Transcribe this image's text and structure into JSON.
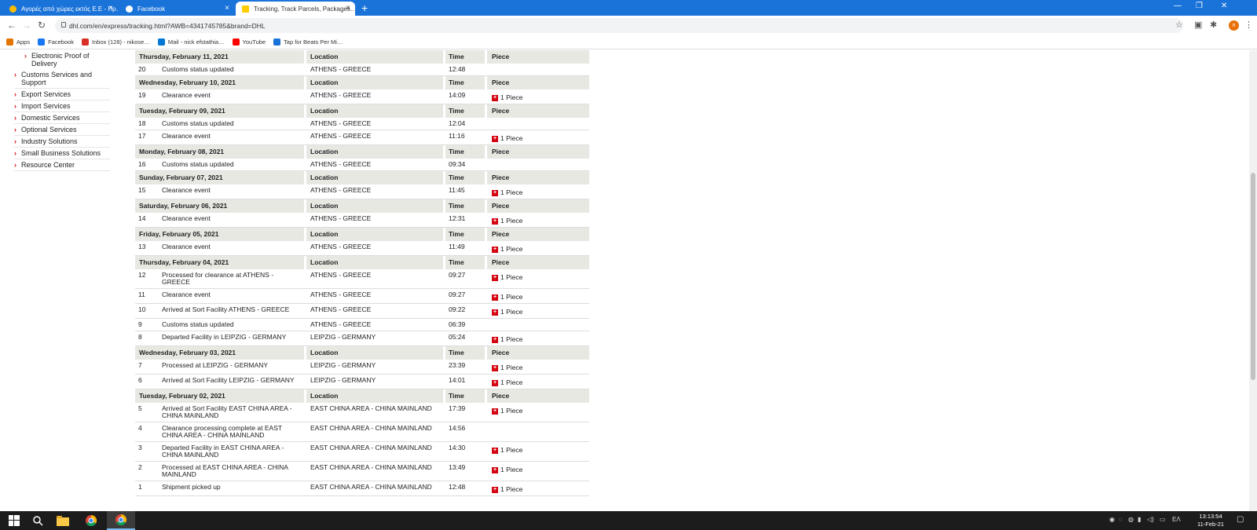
{
  "browser": {
    "tabs": [
      {
        "title": "Αγορές από χώρες εκτός Ε.Ε - Πρ…",
        "icon": "chrome-icon"
      },
      {
        "title": "Facebook",
        "icon": "facebook-icon"
      },
      {
        "title": "Tracking, Track Parcels, Packages…",
        "icon": "dhl-icon"
      }
    ],
    "url": "dhl.com/en/express/tracking.html?AWB=4341745785&brand=DHL",
    "bookmarks": [
      {
        "label": "Apps",
        "icon": "apps-icon",
        "color": "#e37400"
      },
      {
        "label": "Facebook",
        "icon": "facebook-icon",
        "color": "#1877f2"
      },
      {
        "label": "Inbox (128) - nikose…",
        "icon": "gmail-icon",
        "color": "#d93025"
      },
      {
        "label": "Mail - nick efstathia…",
        "icon": "outlook-icon",
        "color": "#0078d4"
      },
      {
        "label": "YouTube",
        "icon": "youtube-icon",
        "color": "#ff0000"
      },
      {
        "label": "Tap for Beats Per Mi…",
        "icon": "beats-icon",
        "color": "#1a73d9"
      }
    ],
    "avatar": "n"
  },
  "sidebar": {
    "sub_item": "Electronic Proof of Delivery",
    "items": [
      "Customs Services and Support",
      "Export Services",
      "Import Services",
      "Domestic Services",
      "Optional Services",
      "Industry Solutions",
      "Small Business Solutions",
      "Resource Center"
    ]
  },
  "table": {
    "headers": {
      "location": "Location",
      "time": "Time",
      "piece": "Piece"
    },
    "piece_label": "1 Piece",
    "groups": [
      {
        "date": "Thursday, February 11, 2021",
        "rows": [
          {
            "n": "20",
            "desc": "Customs status updated",
            "loc": "ATHENS - GREECE",
            "time": "12:48",
            "piece": false
          }
        ]
      },
      {
        "date": "Wednesday, February 10, 2021",
        "rows": [
          {
            "n": "19",
            "desc": "Clearance event",
            "loc": "ATHENS - GREECE",
            "time": "14:09",
            "piece": true
          }
        ]
      },
      {
        "date": "Tuesday, February 09, 2021",
        "rows": [
          {
            "n": "18",
            "desc": "Customs status updated",
            "loc": "ATHENS - GREECE",
            "time": "12:04",
            "piece": false
          },
          {
            "n": "17",
            "desc": "Clearance event",
            "loc": "ATHENS - GREECE",
            "time": "11:16",
            "piece": true
          }
        ]
      },
      {
        "date": "Monday, February 08, 2021",
        "rows": [
          {
            "n": "16",
            "desc": "Customs status updated",
            "loc": "ATHENS - GREECE",
            "time": "09:34",
            "piece": false
          }
        ]
      },
      {
        "date": "Sunday, February 07, 2021",
        "rows": [
          {
            "n": "15",
            "desc": "Clearance event",
            "loc": "ATHENS - GREECE",
            "time": "11:45",
            "piece": true
          }
        ]
      },
      {
        "date": "Saturday, February 06, 2021",
        "rows": [
          {
            "n": "14",
            "desc": "Clearance event",
            "loc": "ATHENS - GREECE",
            "time": "12:31",
            "piece": true
          }
        ]
      },
      {
        "date": "Friday, February 05, 2021",
        "rows": [
          {
            "n": "13",
            "desc": "Clearance event",
            "loc": "ATHENS - GREECE",
            "time": "11:49",
            "piece": true
          }
        ]
      },
      {
        "date": "Thursday, February 04, 2021",
        "rows": [
          {
            "n": "12",
            "desc": "Processed for clearance at ATHENS - GREECE",
            "loc": "ATHENS - GREECE",
            "time": "09:27",
            "piece": true
          },
          {
            "n": "11",
            "desc": "Clearance event",
            "loc": "ATHENS - GREECE",
            "time": "09:27",
            "piece": true
          },
          {
            "n": "10",
            "desc": "Arrived at Sort Facility ATHENS - GREECE",
            "loc": "ATHENS - GREECE",
            "time": "09:22",
            "piece": true
          },
          {
            "n": "9",
            "desc": "Customs status updated",
            "loc": "ATHENS - GREECE",
            "time": "06:39",
            "piece": false
          },
          {
            "n": "8",
            "desc": "Departed Facility in LEIPZIG - GERMANY",
            "loc": "LEIPZIG - GERMANY",
            "time": "05:24",
            "piece": true
          }
        ]
      },
      {
        "date": "Wednesday, February 03, 2021",
        "rows": [
          {
            "n": "7",
            "desc": "Processed at LEIPZIG - GERMANY",
            "loc": "LEIPZIG - GERMANY",
            "time": "23:39",
            "piece": true
          },
          {
            "n": "6",
            "desc": "Arrived at Sort Facility LEIPZIG - GERMANY",
            "loc": "LEIPZIG - GERMANY",
            "time": "14:01",
            "piece": true
          }
        ]
      },
      {
        "date": "Tuesday, February 02, 2021",
        "rows": [
          {
            "n": "5",
            "desc": "Arrived at Sort Facility EAST CHINA AREA - CHINA MAINLAND",
            "loc": "EAST CHINA AREA - CHINA MAINLAND",
            "time": "17:39",
            "piece": true
          },
          {
            "n": "4",
            "desc": "Clearance processing complete at EAST CHINA AREA - CHINA MAINLAND",
            "loc": "EAST CHINA AREA - CHINA MAINLAND",
            "time": "14:56",
            "piece": false
          },
          {
            "n": "3",
            "desc": "Departed Facility in EAST CHINA AREA - CHINA MAINLAND",
            "loc": "EAST CHINA AREA - CHINA MAINLAND",
            "time": "14:30",
            "piece": true
          },
          {
            "n": "2",
            "desc": "Processed at EAST CHINA AREA - CHINA MAINLAND",
            "loc": "EAST CHINA AREA - CHINA MAINLAND",
            "time": "13:49",
            "piece": true
          },
          {
            "n": "1",
            "desc": "Shipment picked up",
            "loc": "EAST CHINA AREA - CHINA MAINLAND",
            "time": "12:48",
            "piece": true
          }
        ]
      }
    ]
  },
  "taskbar": {
    "language": "ΕΛ",
    "time": "13:13:54",
    "date": "11-Feb-21"
  }
}
